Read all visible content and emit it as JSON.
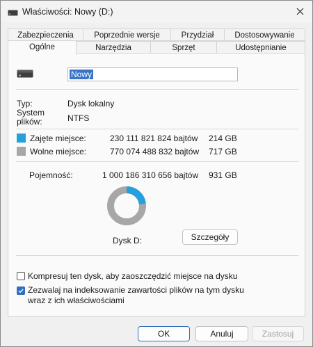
{
  "window": {
    "title": "Właściwości: Nowy (D:)"
  },
  "tabs_row1": [
    "Zabezpieczenia",
    "Poprzednie wersje",
    "Przydział",
    "Dostosowywanie"
  ],
  "tabs_row2": [
    "Ogólne",
    "Narzędzia",
    "Sprzęt",
    "Udostępnianie"
  ],
  "active_tab": "Ogólne",
  "drive": {
    "name": "Nowy"
  },
  "info": {
    "type_label": "Typ:",
    "type_value": "Dysk lokalny",
    "fs_label_line1": "System",
    "fs_label_line2": "plików:",
    "fs_value": "NTFS"
  },
  "usage": {
    "used_label": "Zajęte miejsce:",
    "used_bytes": "230 111 821 824 bajtów",
    "used_gb": "214 GB",
    "free_label": "Wolne miejsce:",
    "free_bytes": "770 074 488 832 bajtów",
    "free_gb": "717 GB",
    "capacity_label": "Pojemność:",
    "capacity_bytes": "1 000 186 310 656 bajtów",
    "capacity_gb": "931 GB",
    "used_fraction": 0.23,
    "used_color": "#26a0da",
    "free_color": "#a7a7a7"
  },
  "disk_label": "Dysk D:",
  "details_button": "Szczegóły",
  "options": {
    "compress_label": "Kompresuj ten dysk, aby zaoszczędzić miejsce na dysku",
    "compress_checked": false,
    "index_label_line1": "Zezwalaj na indeksowanie zawartości plików na tym dysku",
    "index_label_line2": "wraz z ich właściwościami",
    "index_checked": true
  },
  "buttons": {
    "ok": "OK",
    "cancel": "Anuluj",
    "apply": "Zastosuj"
  }
}
